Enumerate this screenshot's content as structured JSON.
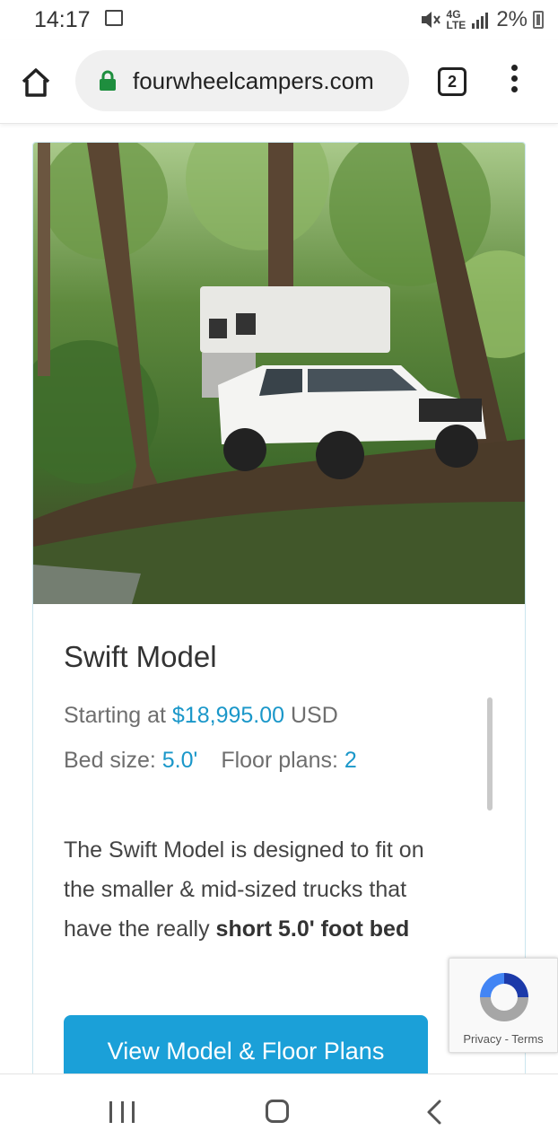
{
  "status_bar": {
    "time": "14:17",
    "network": "4G LTE",
    "battery": "2%",
    "icons": [
      "image-icon",
      "mute-icon",
      "lte-icon",
      "signal-icon",
      "battery-charging-icon"
    ]
  },
  "browser": {
    "url": "fourwheelcampers.com",
    "tab_count": "2",
    "icons": [
      "home-icon",
      "lock-icon",
      "tabs-icon",
      "more-vert-icon"
    ]
  },
  "card": {
    "title": "Swift Model",
    "price_prefix": "Starting at ",
    "price": "$18,995.00",
    "price_suffix": " USD",
    "bed_label": "Bed size: ",
    "bed_value": "5.0'",
    "floor_label": "Floor plans: ",
    "floor_value": "2",
    "description_part1": "The Swift Model is designed to fit on the smaller & mid-sized trucks that have the really ",
    "description_bold": "short 5.0' foot bed",
    "cta_label": "View Model & Floor Plans"
  },
  "recaptcha": {
    "privacy": "Privacy",
    "separator": " - ",
    "terms": "Terms"
  },
  "nav": {
    "icons": [
      "recent-apps-icon",
      "home-icon",
      "back-icon"
    ]
  },
  "colors": {
    "accent": "#1a97c9",
    "button": "#1ba0d8",
    "card_border": "#cbe6ef",
    "url_pill": "#f0f0f0"
  }
}
